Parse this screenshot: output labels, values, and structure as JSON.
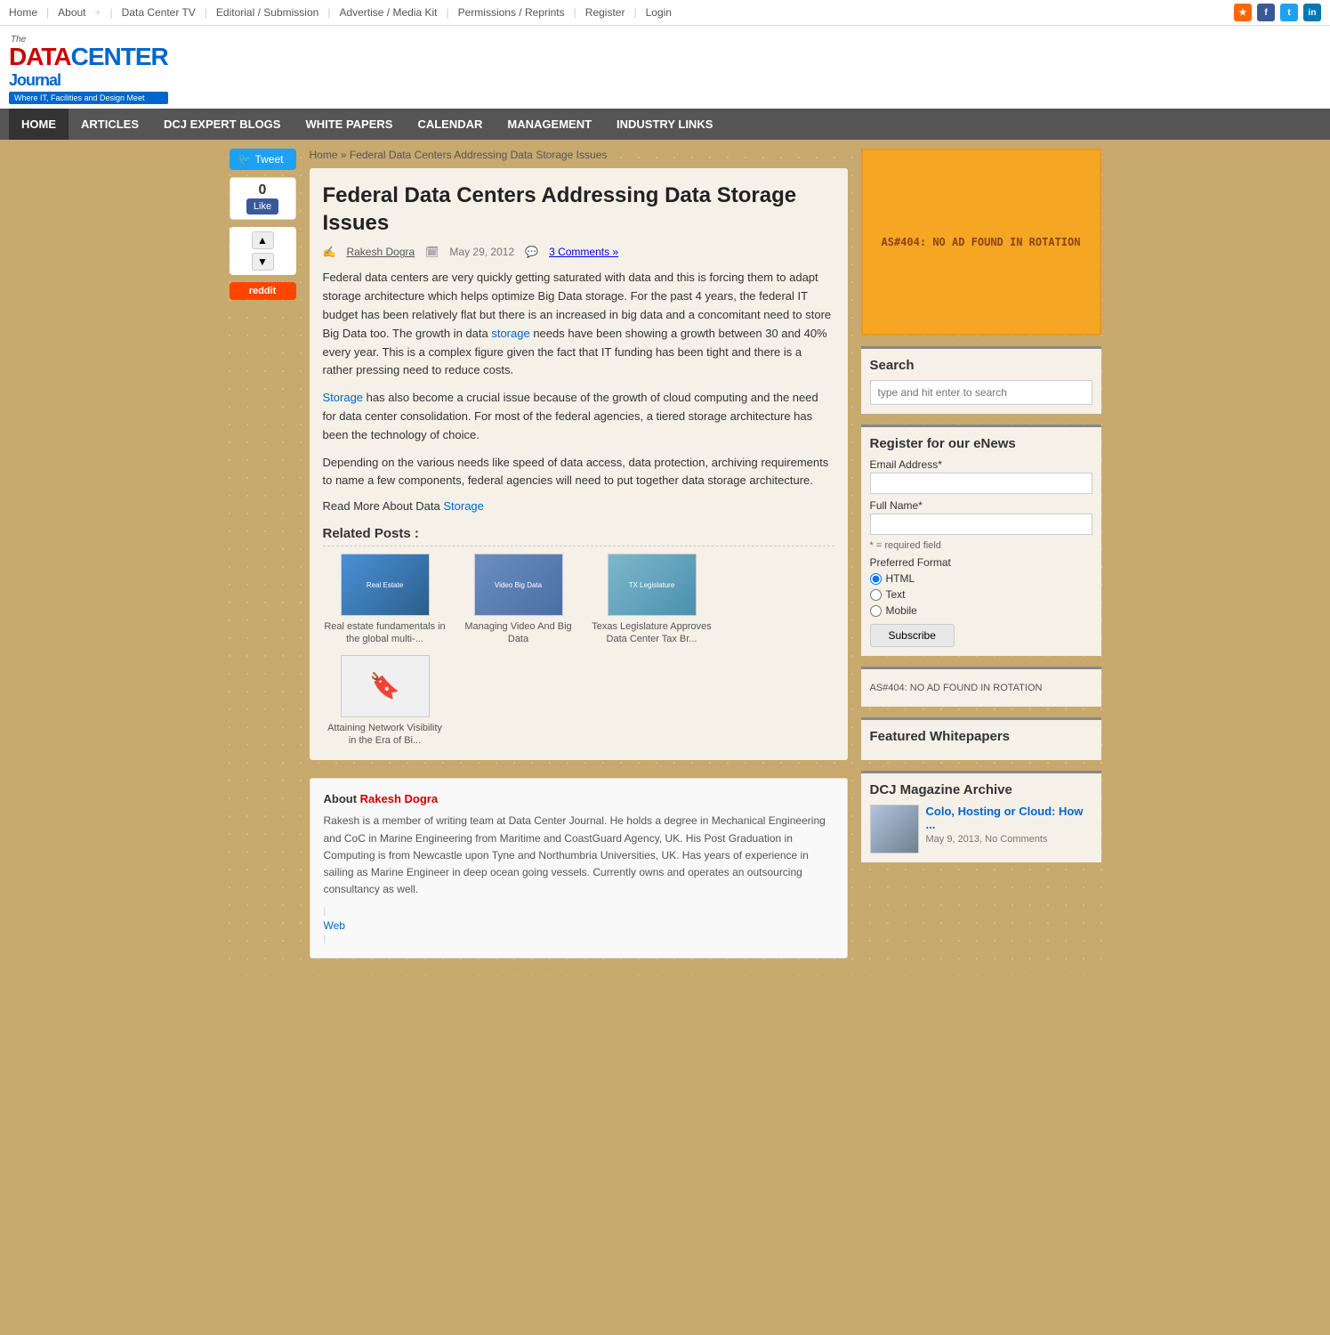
{
  "topNav": {
    "links": [
      "Home",
      "About",
      "Data Center TV",
      "Editorial / Submission",
      "Advertise / Media Kit",
      "Permissions / Reprints",
      "Register",
      "Login"
    ],
    "icons": [
      "rss",
      "facebook",
      "twitter",
      "linkedin"
    ]
  },
  "logo": {
    "the": "The",
    "data": "DATA",
    "center": "CENTER",
    "journal": "Journal",
    "tagline": "Where IT, Facilities and Design Meet"
  },
  "mainNav": {
    "items": [
      "HOME",
      "ARTICLES",
      "DCJ EXPERT BLOGS",
      "WHITE PAPERS",
      "CALENDAR",
      "MANAGEMENT",
      "INDUSTRY LINKS"
    ]
  },
  "breadcrumb": {
    "home": "Home",
    "current": "Federal Data Centers Addressing Data Storage Issues"
  },
  "article": {
    "title": "Federal Data Centers Addressing Data Storage Issues",
    "author": "Rakesh Dogra",
    "date": "May 29, 2012",
    "comments": "3 Comments »",
    "body1": "Federal data centers are very quickly getting saturated with data and this is forcing them to adapt storage architecture which helps optimize Big Data storage. For the past 4 years, the federal IT budget has been relatively flat but there is an increased in big data and a concomitant need to store Big Data too. The growth in data storage needs have been showing a growth between 30 and 40% every year. This is a complex figure given the fact that IT funding has been tight and there is a rather pressing need to reduce costs.",
    "body2": "Storage has also become a crucial issue because of the growth of cloud computing and the need for data center consolidation. For most of the federal agencies, a tiered storage architecture has been the technology of choice.",
    "body3": "Depending on the various needs like speed of data access, data protection, archiving requirements to name a few components, federal agencies will need to put together data storage architecture.",
    "readMore": "Read More About Data Storage"
  },
  "relatedPosts": {
    "title": "Related Posts :",
    "items": [
      {
        "caption": "Real estate fundamentals in the global multi-..."
      },
      {
        "caption": "Managing Video And Big Data"
      },
      {
        "caption": "Texas Legislature Approves Data Center Tax Br..."
      },
      {
        "caption": "Attaining Network Visibility in the Era of Bi..."
      }
    ]
  },
  "authorBox": {
    "label": "About",
    "name": "Rakesh Dogra",
    "bio": "Rakesh is a member of writing team at Data Center Journal. He holds a degree in Mechanical Engineering and CoC in Marine Engineering from Maritime and CoastGuard Agency, UK. His Post Graduation in Computing is from Newcastle upon Tyne and Northumbria Universities, UK. Has years of experience in sailing as Marine Engineer in deep ocean going vessels. Currently owns and operates an outsourcing consultancy as well.",
    "webLabel": "Web"
  },
  "sidebar": {
    "adText": "AS#404: NO AD FOUND IN ROTATION",
    "search": {
      "title": "Search",
      "placeholder": "type and hit enter to search"
    },
    "enews": {
      "title": "Register for our eNews",
      "emailLabel": "Email Address*",
      "nameLabel": "Full Name*",
      "requiredNote": "* = required field",
      "formatLabel": "Preferred Format",
      "options": [
        "HTML",
        "Text",
        "Mobile"
      ],
      "subscribeBtn": "Subscribe"
    },
    "adTextSmall": "AS#404: NO AD FOUND IN ROTATION",
    "featuredWhitepapers": {
      "title": "Featured Whitepapers"
    },
    "magazineArchive": {
      "title": "DCJ Magazine Archive",
      "item": {
        "title": "Colo, Hosting or Cloud: How ...",
        "date": "May 9, 2013",
        "comments": "No Comments"
      }
    }
  },
  "social": {
    "tweetLabel": "Tweet",
    "likeCount": "0",
    "likeLabel": "Like",
    "redditLabel": "reddit"
  }
}
